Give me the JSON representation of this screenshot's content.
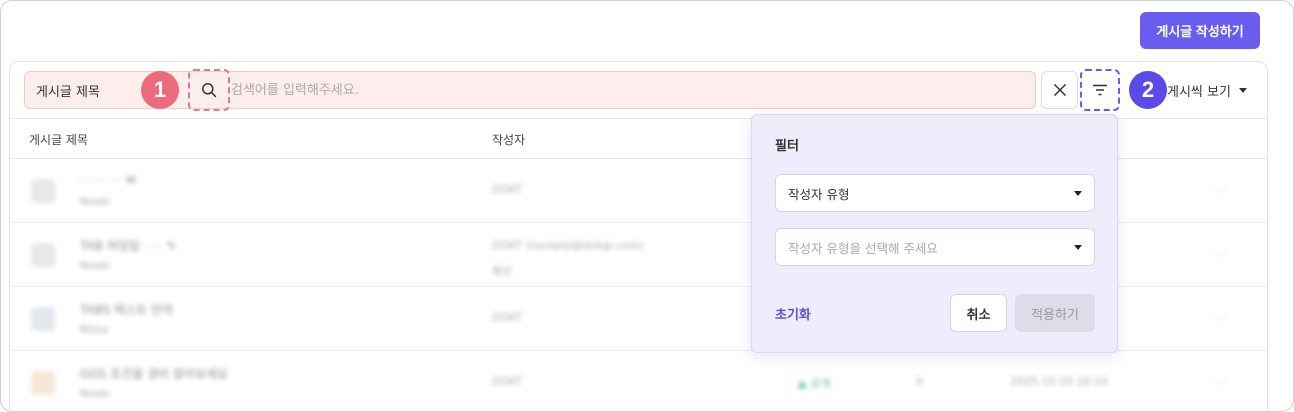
{
  "header": {
    "write_button_label": "게시글 작성하기"
  },
  "search": {
    "field_select_label": "게시글 제목",
    "placeholder": "검색어를 입력해주세요.",
    "value": ""
  },
  "markers": {
    "one": "1",
    "two": "2"
  },
  "toolbar": {
    "view_label": "게시씩 보기"
  },
  "table": {
    "columns": [
      "게시글 제목",
      "작성자"
    ],
    "rows": [
      {
        "title": "· · · · · · ✉",
        "sub": "Noski",
        "author": "DOKT",
        "author2": "",
        "status": "",
        "num": "",
        "date": ""
      },
      {
        "title": "TAB 여덩일 · · · ✎",
        "sub": "Noski",
        "author": "DOKT (noreply@dokgi.com)",
        "author2": "확인",
        "status": "",
        "num": "",
        "date": ""
      },
      {
        "title": "TABS 텍스트 안의",
        "sub": "NUoz",
        "author": "DOKT",
        "author2": "",
        "status": "",
        "num": "",
        "date": ""
      },
      {
        "title": "GGS 조건을 경비 알아보세요",
        "sub": "Noski",
        "author": "DOKT",
        "author2": "",
        "status": "▲ 공개",
        "num": "0",
        "date": "2025.10.10 10:10"
      }
    ],
    "more_label": "···"
  },
  "filter_popover": {
    "title": "필터",
    "type_select_label": "작성자 유형",
    "value_select_placeholder": "작성자 유형을 선택해 주세요",
    "reset_label": "초기화",
    "cancel_label": "취소",
    "apply_label": "적용하기"
  },
  "colors": {
    "accent": "#6b5cf0",
    "marker_one": "#ec6b7d",
    "marker_two": "#5b49e8",
    "search_bg": "#fdeeee",
    "popover_bg": "#eeedfc"
  },
  "icons": {
    "search": "search-icon",
    "clear": "close-icon",
    "filter": "filter-lines-icon",
    "caret": "caret-down-icon"
  }
}
